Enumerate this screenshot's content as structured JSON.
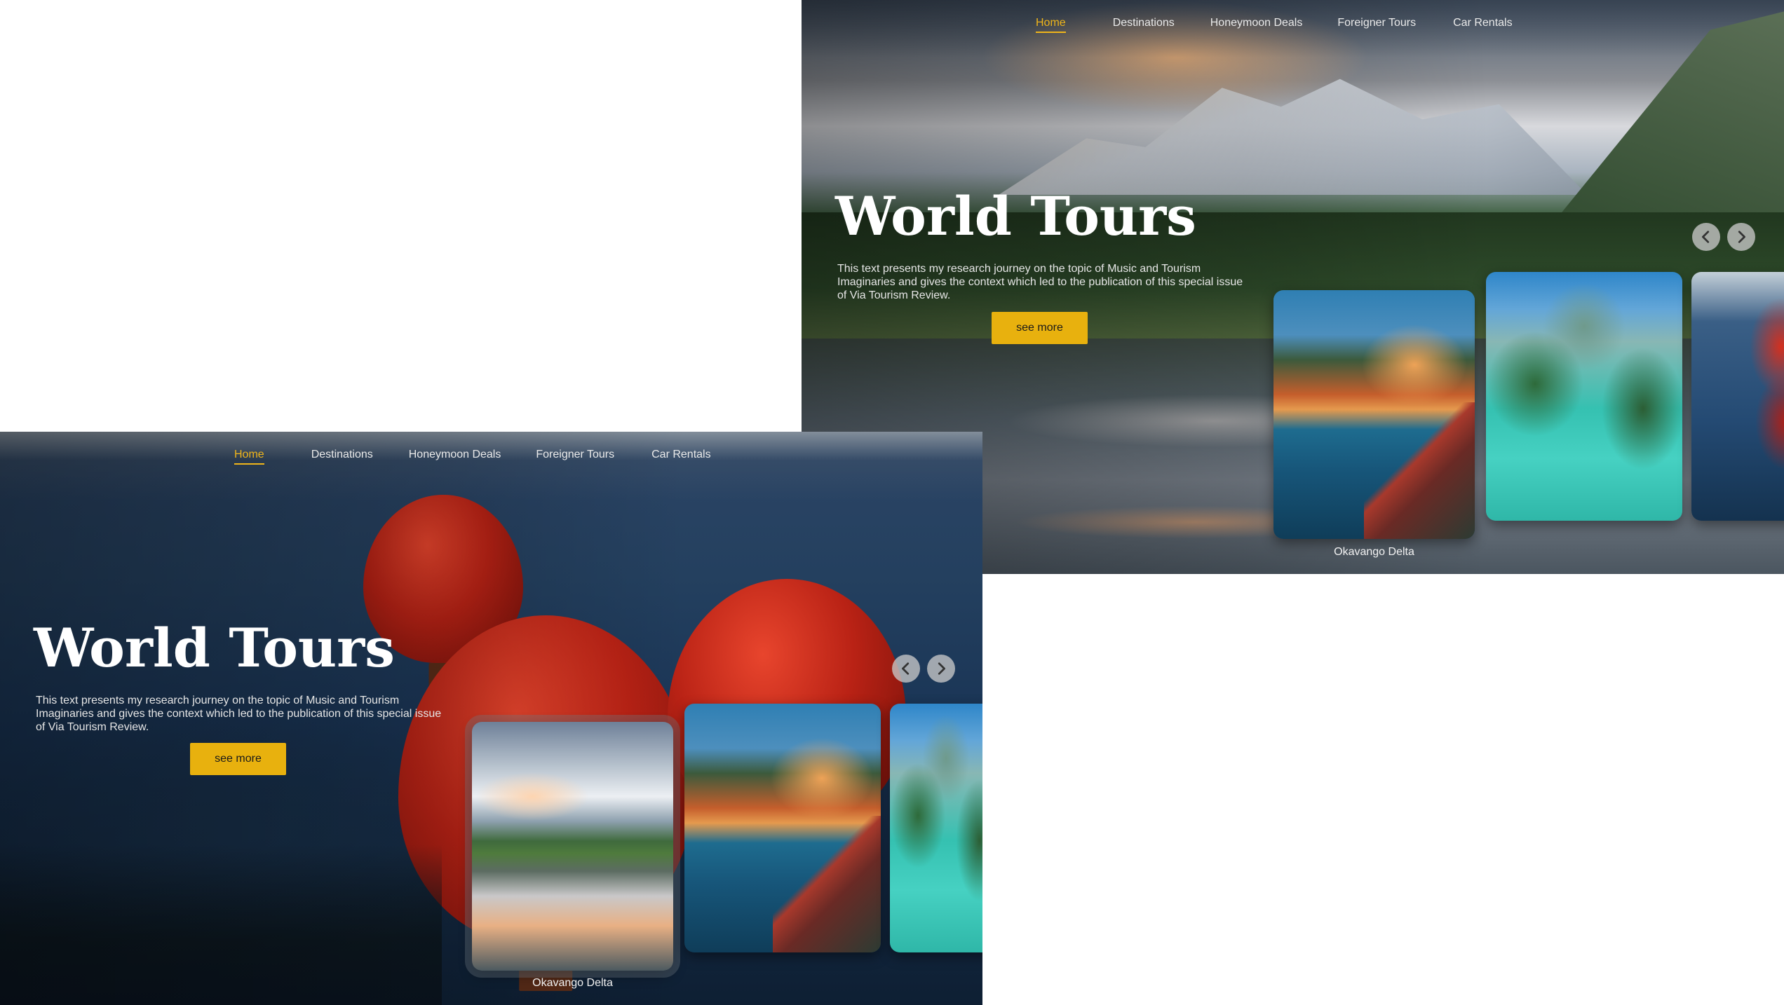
{
  "nav": {
    "items": [
      "Home",
      "Destinations",
      "Honeymoon Deals",
      "Foreigner Tours",
      "Car Rentals"
    ],
    "active": "Home"
  },
  "hero": {
    "title": "World Tours",
    "text": "This text presents my research journey on the topic of Music and Tourism Imaginaries and gives the context which led to the publication of this special issue of Via Tourism Review.",
    "button_label": "see more"
  },
  "carousel": {
    "caption": "Okavango Delta",
    "prev_icon": "chevron-left-icon",
    "next_icon": "chevron-right-icon"
  },
  "colors": {
    "accent": "#f0b51a",
    "button": "#e8b10e",
    "text": "#ffffff"
  }
}
